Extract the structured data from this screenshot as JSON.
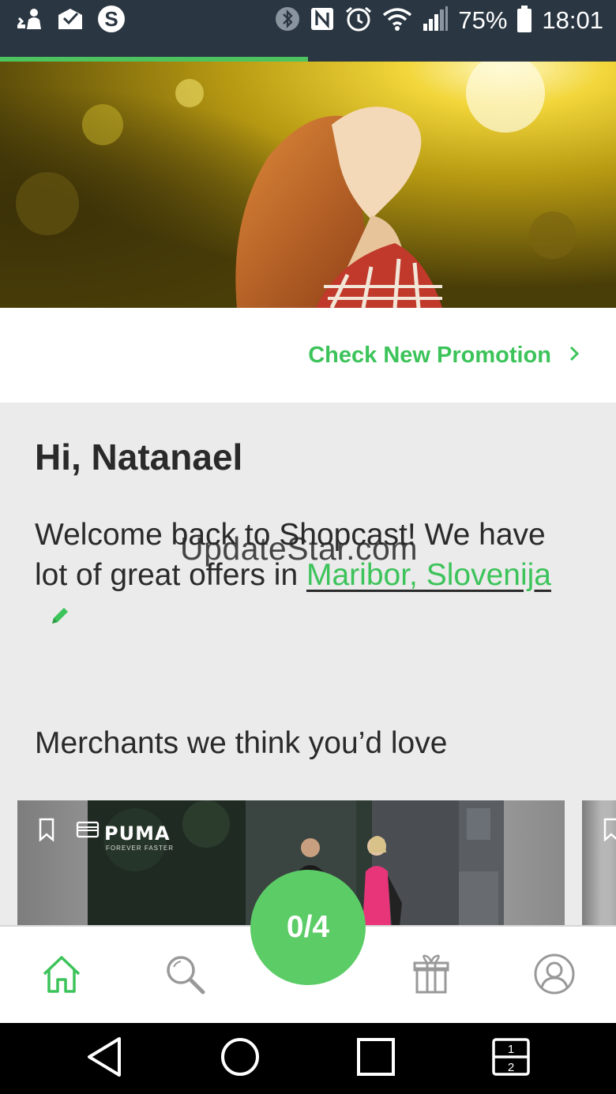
{
  "status_bar": {
    "battery": "75%",
    "time": "18:01",
    "left_icons": [
      "sync-user-icon",
      "mail-check-icon",
      "skype-icon"
    ],
    "right_icons": [
      "bluetooth-icon",
      "nfc-icon",
      "alarm-icon",
      "wifi-icon",
      "signal-icon",
      "battery-icon"
    ]
  },
  "loading_progress": 0.5,
  "promo": {
    "label": "Check New Promotion",
    "icon": "chevron-right-icon"
  },
  "greeting": "Hi, Natanael",
  "welcome": {
    "text": "Welcome back to Shopcast! We have lot of great offers in ",
    "location": "Maribor, Slovenija",
    "edit_icon": "pencil-icon"
  },
  "watermark": "UpdateStar.com",
  "merchants": {
    "title": "Merchants we think you’d love",
    "cards": [
      {
        "brand_logo": "PUMA",
        "brand_tagline": "FOREVER FASTER",
        "icons": [
          "bookmark-icon",
          "wallet-card-icon"
        ]
      },
      {
        "icons": [
          "bookmark-icon"
        ]
      }
    ]
  },
  "bottom_nav": {
    "items": [
      {
        "name": "home",
        "icon": "home-icon",
        "active": true
      },
      {
        "name": "search",
        "icon": "search-icon",
        "active": false
      },
      {
        "name": "rewards",
        "icon": "gift-icon",
        "active": false
      },
      {
        "name": "profile",
        "icon": "user-icon",
        "active": false
      }
    ],
    "fab_label": "0/4"
  },
  "system_nav": [
    "back-icon",
    "home-circle-icon",
    "recents-icon",
    "split-screen-icon"
  ],
  "colors": {
    "accent": "#3cc35a",
    "fab": "#5ccc66",
    "status_bar": "#2a3642",
    "background": "#ebebeb"
  }
}
